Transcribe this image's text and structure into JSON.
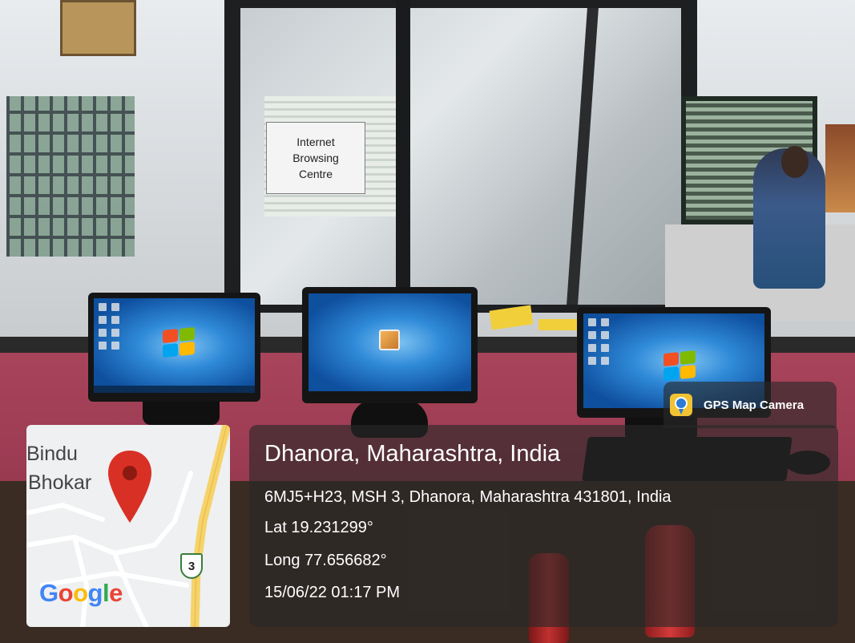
{
  "sign": {
    "text": "Internet\nBrowsing\nCentre"
  },
  "badge": {
    "label": "GPS Map Camera",
    "icon": "gps-map-camera-icon"
  },
  "location": {
    "title": "Dhanora, Maharashtra, India",
    "address": "6MJ5+H23, MSH 3, Dhanora, Maharashtra 431801, India",
    "lat": "Lat 19.231299°",
    "long": "Long 77.656682°",
    "datetime": "15/06/22 01:17 PM"
  },
  "map": {
    "label_1": "Bindu",
    "label_2": "Bhokar",
    "route_shield": "3",
    "logo": {
      "G": "G",
      "o1": "o",
      "o2": "o",
      "g": "g",
      "l": "l",
      "e": "e"
    },
    "pin_color": "#d93025",
    "road_color": "#f6d36a"
  },
  "colors": {
    "overlay": "rgba(40,40,40,0.62)",
    "google_blue": "#4285F4",
    "google_red": "#EA4335",
    "google_yellow": "#FBBC05",
    "google_green": "#34A853"
  }
}
